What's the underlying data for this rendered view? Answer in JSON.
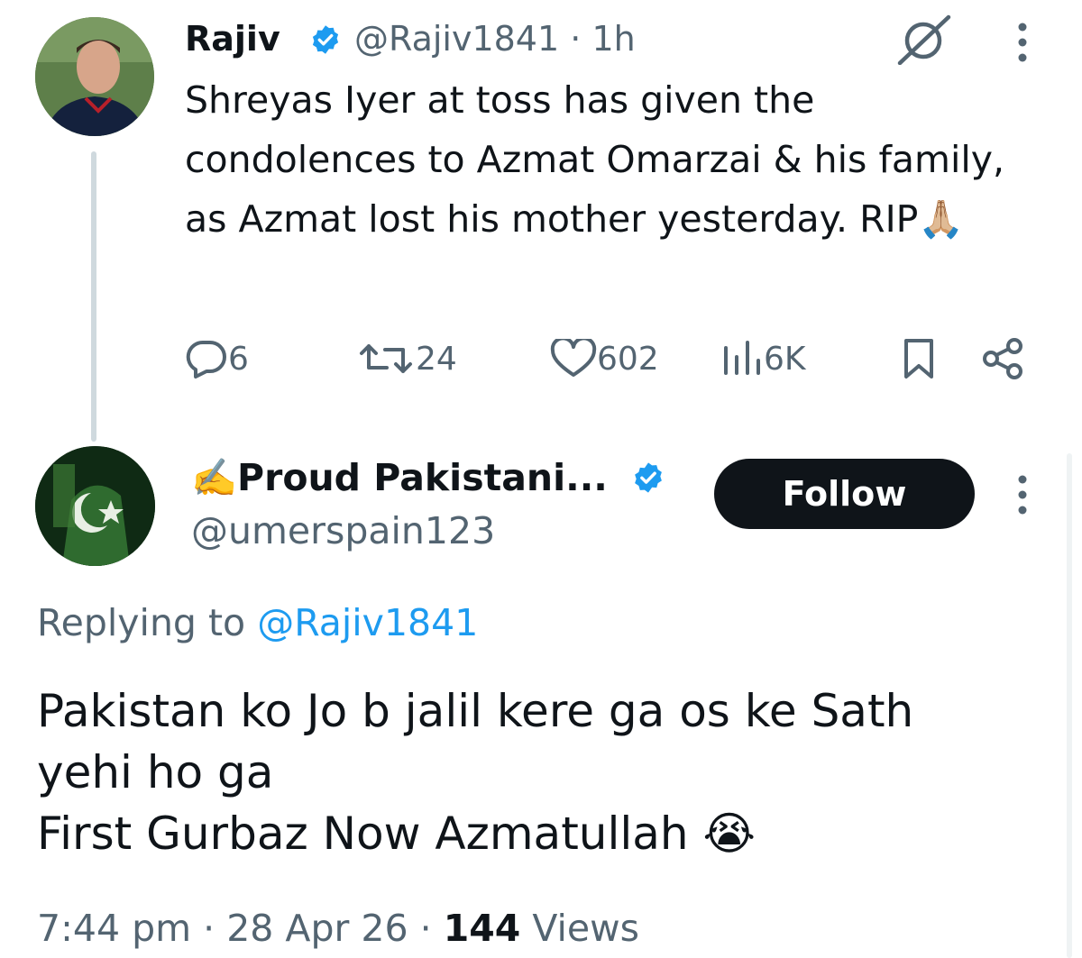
{
  "parent_tweet": {
    "author_name": "Rajiv",
    "handle": "@Rajiv1841",
    "separator": "·",
    "time_ago": "1h",
    "text": "Shreyas Iyer at toss has given the condolences to Azmat Omarzai & his family, as Azmat lost his mother yesterday. RIP🙏🏼",
    "stats": {
      "replies": "6",
      "retweets": "24",
      "likes": "602",
      "views": "6K"
    }
  },
  "reply_tweet": {
    "author_name": "✍️Proud Pakistani...",
    "handle": "@umerspain123",
    "follow_label": "Follow",
    "replying_prefix": "Replying to ",
    "replying_mention": "@Rajiv1841",
    "text_lines": [
      "Pakistan ko Jo b jalil kere ga os ke Sath",
      "yehi ho ga",
      "First Gurbaz Now Azmatullah 😭"
    ],
    "time": "7:44 pm",
    "date": "28 Apr 26",
    "separator": "·",
    "view_count": "144",
    "views_label": "Views"
  },
  "colors": {
    "text_primary": "#0f1419",
    "text_secondary": "#536471",
    "accent_blue": "#1d9bf0",
    "follow_bg": "#0f1419"
  },
  "icons": {
    "verified": "verified-badge-icon",
    "grok": "grok-icon",
    "more": "more-vertical-icon",
    "reply": "reply-icon",
    "retweet": "retweet-icon",
    "like": "heart-icon",
    "views": "views-chart-icon",
    "bookmark": "bookmark-icon",
    "share": "share-icon"
  }
}
